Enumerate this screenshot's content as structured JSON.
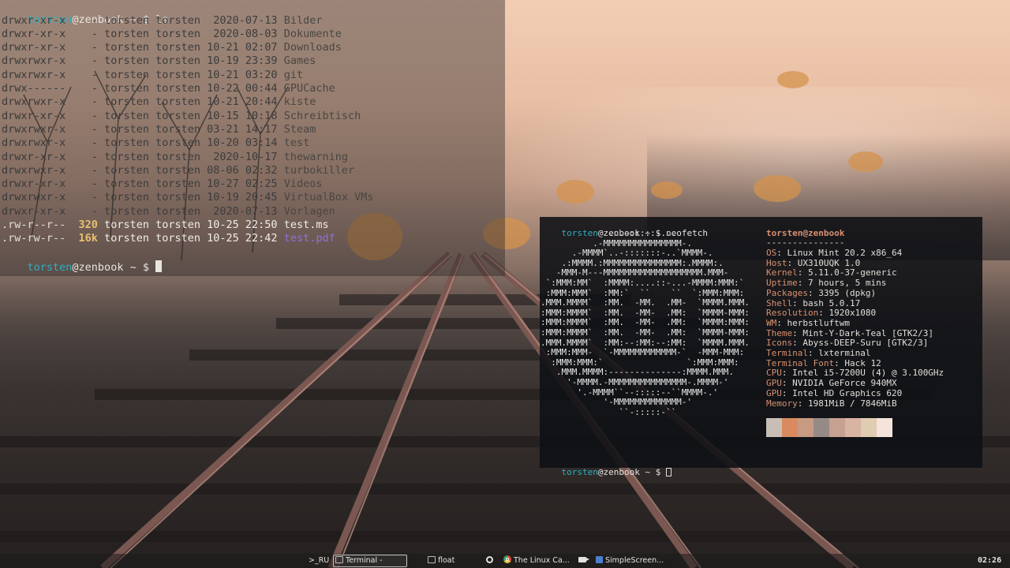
{
  "left_terminal": {
    "prompt_user": "torsten",
    "prompt_host": "@zenbook",
    "prompt_suffix": " ~ $ ",
    "command": "ls",
    "entries": [
      {
        "perms": "drwxr-xr-x",
        "size": "-",
        "owner": "torsten torsten",
        "date": "2020-07-13",
        "name": "Bilder",
        "type": "dir"
      },
      {
        "perms": "drwxr-xr-x",
        "size": "-",
        "owner": "torsten torsten",
        "date": "2020-08-03",
        "name": "Dokumente",
        "type": "dir"
      },
      {
        "perms": "drwxr-xr-x",
        "size": "-",
        "owner": "torsten torsten",
        "date": "10-21 02:07",
        "name": "Downloads",
        "type": "dir"
      },
      {
        "perms": "drwxrwxr-x",
        "size": "-",
        "owner": "torsten torsten",
        "date": "10-19 23:39",
        "name": "Games",
        "type": "dir"
      },
      {
        "perms": "drwxrwxr-x",
        "size": "-",
        "owner": "torsten torsten",
        "date": "10-21 03:20",
        "name": "git",
        "type": "dir"
      },
      {
        "perms": "drwx------",
        "size": "-",
        "owner": "torsten torsten",
        "date": "10-22 00:44",
        "name": "GPUCache",
        "type": "dir"
      },
      {
        "perms": "drwxrwxr-x",
        "size": "-",
        "owner": "torsten torsten",
        "date": "10-21 20:44",
        "name": "kiste",
        "type": "dir"
      },
      {
        "perms": "drwxr-xr-x",
        "size": "-",
        "owner": "torsten torsten",
        "date": "10-15 10:18",
        "name": "Schreibtisch",
        "type": "dir"
      },
      {
        "perms": "drwxrwxr-x",
        "size": "-",
        "owner": "torsten torsten",
        "date": "03-21 14:17",
        "name": "Steam",
        "type": "dir"
      },
      {
        "perms": "drwxrwxr-x",
        "size": "-",
        "owner": "torsten torsten",
        "date": "10-20 03:14",
        "name": "test",
        "type": "dir"
      },
      {
        "perms": "drwxr-xr-x",
        "size": "-",
        "owner": "torsten torsten",
        "date": "2020-10-17",
        "name": "thewarning",
        "type": "dir"
      },
      {
        "perms": "drwxrwxr-x",
        "size": "-",
        "owner": "torsten torsten",
        "date": "08-06 02:32",
        "name": "turbokiller",
        "type": "dir"
      },
      {
        "perms": "drwxr-xr-x",
        "size": "-",
        "owner": "torsten torsten",
        "date": "10-27 02:25",
        "name": "Videos",
        "type": "dir"
      },
      {
        "perms": "drwxrwxr-x",
        "size": "-",
        "owner": "torsten torsten",
        "date": "10-19 20:45",
        "name": "VirtualBox VMs",
        "type": "dir"
      },
      {
        "perms": "drwxr-xr-x",
        "size": "-",
        "owner": "torsten torsten",
        "date": "2020-07-13",
        "name": "Vorlagen",
        "type": "dir"
      },
      {
        "perms": ".rw-r--r--",
        "size": "320",
        "owner": "torsten torsten",
        "date": "10-25 22:50",
        "name": "test.ms",
        "type": "file"
      },
      {
        "perms": ".rw-rw-r--",
        "size": "16k",
        "owner": "torsten torsten",
        "date": "10-25 22:42",
        "name": "test.pdf",
        "type": "pdf"
      }
    ]
  },
  "right_terminal": {
    "prompt_user": "torsten",
    "prompt_host": "@zenbook",
    "prompt_suffix": " ~ $ ",
    "command": "neofetch",
    "ascii_art": [
      "             ...-:::::-...",
      "          .-MMMMMMMMMMMMMMM-.",
      "      .-MMMM`..-:::::::-..`MMMM-.",
      "    .:MMMM.:MMMMMMMMMMMMMMM:.MMMM:.",
      "   -MMM-M---MMMMMMMMMMMMMMMMMMM.MMM-",
      " `:MMM:MM`  :MMMM:....::-...-MMMM:MMM:`",
      " :MMM:MMM`  :MM:`  ``    ``  `:MMM:MMM:",
      ".MMM.MMMM`  :MM.  -MM.  .MM-  `MMMM.MMM.",
      ":MMM:MMMM`  :MM.  -MM-  .MM:  `MMMM-MMM:",
      ":MMM:MMMM`  :MM.  -MM-  .MM:  `MMMM:MMM:",
      ":MMM:MMMM`  :MM.  -MM-  .MM:  `MMMM-MMM:",
      ".MMM.MMMM`  :MM:--:MM:--:MM:  `MMMM.MMM.",
      " :MMM:MMM-  `-MMMMMMMMMMMM-`  -MMM-MMM:",
      "  :MMM:MMM:`                `:MMM:MMM:",
      "   .MMM.MMMM:--------------:MMMM.MMM.",
      "     '-MMMM.-MMMMMMMMMMMMMMM-.MMMM-'",
      "       '.-MMMM``--:::::--``MMMM-.'",
      "            '-MMMMMMMMMMMMM-'",
      "               ``-:::::-``"
    ],
    "user_at_host": "torsten@zenbook",
    "separator": "---------------",
    "info": [
      {
        "key": "OS",
        "value": "Linux Mint 20.2 x86_64"
      },
      {
        "key": "Host",
        "value": "UX310UQK 1.0"
      },
      {
        "key": "Kernel",
        "value": "5.11.0-37-generic"
      },
      {
        "key": "Uptime",
        "value": "7 hours, 5 mins"
      },
      {
        "key": "Packages",
        "value": "3395 (dpkg)"
      },
      {
        "key": "Shell",
        "value": "bash 5.0.17"
      },
      {
        "key": "Resolution",
        "value": "1920x1080"
      },
      {
        "key": "WM",
        "value": "herbstluftwm"
      },
      {
        "key": "Theme",
        "value": "Mint-Y-Dark-Teal [GTK2/3]"
      },
      {
        "key": "Icons",
        "value": "Abyss-DEEP-Suru [GTK2/3]"
      },
      {
        "key": "Terminal",
        "value": "lxterminal"
      },
      {
        "key": "Terminal Font",
        "value": "Hack 12"
      },
      {
        "key": "CPU",
        "value": "Intel i5-7200U (4) @ 3.100GHz"
      },
      {
        "key": "GPU",
        "value": "NVIDIA GeForce 940MX"
      },
      {
        "key": "GPU",
        "value": "Intel HD Graphics 620"
      },
      {
        "key": "Memory",
        "value": "1981MiB / 7846MiB"
      }
    ],
    "palette": [
      "#c8beb6",
      "#d98b5f",
      "#c79a82",
      "#968a86",
      "#c6a090",
      "#d8b4a4",
      "#e0ccb0",
      "#f4e4dc"
    ]
  },
  "taskbar": {
    "layout_label": ">_RU",
    "terminal_label": "Terminal -",
    "float_label": "float",
    "browser_label": "The Linux Ca...",
    "screencast_label": "SimpleScreen...",
    "clock": "02:26"
  },
  "colors": {
    "prompt_user": "#2fb0c0",
    "neofetch_accent": "#d9906e",
    "pdf_file": "#8f6fe0",
    "size_highlight": "#e8c070"
  }
}
